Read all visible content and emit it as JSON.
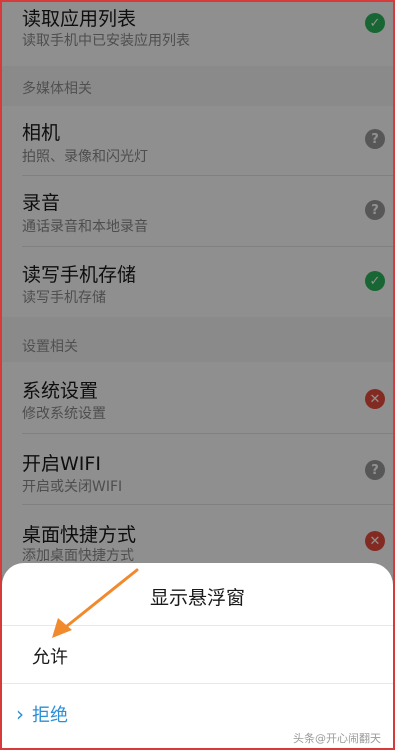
{
  "permissions": {
    "top_item": {
      "title": "读取应用列表",
      "subtitle": "读取手机中已安装应用列表",
      "status": "allowed"
    },
    "sections": [
      {
        "header": "多媒体相关",
        "items": [
          {
            "title": "相机",
            "subtitle": "拍照、录像和闪光灯",
            "status": "ask"
          },
          {
            "title": "录音",
            "subtitle": "通话录音和本地录音",
            "status": "ask"
          },
          {
            "title": "读写手机存储",
            "subtitle": "读写手机存储",
            "status": "allowed"
          }
        ]
      },
      {
        "header": "设置相关",
        "items": [
          {
            "title": "系统设置",
            "subtitle": "修改系统设置",
            "status": "denied"
          },
          {
            "title": "开启WIFI",
            "subtitle": "开启或关闭WIFI",
            "status": "ask"
          },
          {
            "title": "桌面快捷方式",
            "subtitle": "添加桌面快捷方式",
            "status": "denied"
          }
        ]
      }
    ]
  },
  "dialog": {
    "title": "显示悬浮窗",
    "allow_label": "允许",
    "deny_label": "拒绝"
  },
  "watermark": "头条@开心闹翻天",
  "icons": {
    "allowed": "check-icon",
    "ask": "question-icon",
    "denied": "close-icon"
  },
  "colors": {
    "allowed": "#2bb35a",
    "ask": "#999999",
    "denied": "#e74c3c",
    "deny_text": "#2b8fd6",
    "arrow": "#f08a2c",
    "frame": "#d63a3a"
  }
}
